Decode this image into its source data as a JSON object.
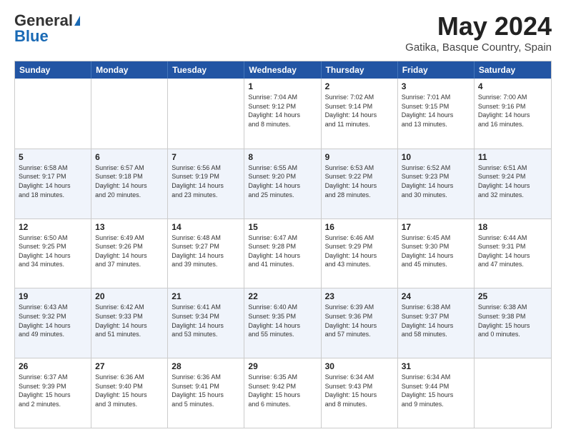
{
  "logo": {
    "line1": "General",
    "line2": "Blue"
  },
  "title": "May 2024",
  "subtitle": "Gatika, Basque Country, Spain",
  "days_of_week": [
    "Sunday",
    "Monday",
    "Tuesday",
    "Wednesday",
    "Thursday",
    "Friday",
    "Saturday"
  ],
  "weeks": [
    [
      {
        "day": "",
        "info": ""
      },
      {
        "day": "",
        "info": ""
      },
      {
        "day": "",
        "info": ""
      },
      {
        "day": "1",
        "info": "Sunrise: 7:04 AM\nSunset: 9:12 PM\nDaylight: 14 hours\nand 8 minutes."
      },
      {
        "day": "2",
        "info": "Sunrise: 7:02 AM\nSunset: 9:14 PM\nDaylight: 14 hours\nand 11 minutes."
      },
      {
        "day": "3",
        "info": "Sunrise: 7:01 AM\nSunset: 9:15 PM\nDaylight: 14 hours\nand 13 minutes."
      },
      {
        "day": "4",
        "info": "Sunrise: 7:00 AM\nSunset: 9:16 PM\nDaylight: 14 hours\nand 16 minutes."
      }
    ],
    [
      {
        "day": "5",
        "info": "Sunrise: 6:58 AM\nSunset: 9:17 PM\nDaylight: 14 hours\nand 18 minutes."
      },
      {
        "day": "6",
        "info": "Sunrise: 6:57 AM\nSunset: 9:18 PM\nDaylight: 14 hours\nand 20 minutes."
      },
      {
        "day": "7",
        "info": "Sunrise: 6:56 AM\nSunset: 9:19 PM\nDaylight: 14 hours\nand 23 minutes."
      },
      {
        "day": "8",
        "info": "Sunrise: 6:55 AM\nSunset: 9:20 PM\nDaylight: 14 hours\nand 25 minutes."
      },
      {
        "day": "9",
        "info": "Sunrise: 6:53 AM\nSunset: 9:22 PM\nDaylight: 14 hours\nand 28 minutes."
      },
      {
        "day": "10",
        "info": "Sunrise: 6:52 AM\nSunset: 9:23 PM\nDaylight: 14 hours\nand 30 minutes."
      },
      {
        "day": "11",
        "info": "Sunrise: 6:51 AM\nSunset: 9:24 PM\nDaylight: 14 hours\nand 32 minutes."
      }
    ],
    [
      {
        "day": "12",
        "info": "Sunrise: 6:50 AM\nSunset: 9:25 PM\nDaylight: 14 hours\nand 34 minutes."
      },
      {
        "day": "13",
        "info": "Sunrise: 6:49 AM\nSunset: 9:26 PM\nDaylight: 14 hours\nand 37 minutes."
      },
      {
        "day": "14",
        "info": "Sunrise: 6:48 AM\nSunset: 9:27 PM\nDaylight: 14 hours\nand 39 minutes."
      },
      {
        "day": "15",
        "info": "Sunrise: 6:47 AM\nSunset: 9:28 PM\nDaylight: 14 hours\nand 41 minutes."
      },
      {
        "day": "16",
        "info": "Sunrise: 6:46 AM\nSunset: 9:29 PM\nDaylight: 14 hours\nand 43 minutes."
      },
      {
        "day": "17",
        "info": "Sunrise: 6:45 AM\nSunset: 9:30 PM\nDaylight: 14 hours\nand 45 minutes."
      },
      {
        "day": "18",
        "info": "Sunrise: 6:44 AM\nSunset: 9:31 PM\nDaylight: 14 hours\nand 47 minutes."
      }
    ],
    [
      {
        "day": "19",
        "info": "Sunrise: 6:43 AM\nSunset: 9:32 PM\nDaylight: 14 hours\nand 49 minutes."
      },
      {
        "day": "20",
        "info": "Sunrise: 6:42 AM\nSunset: 9:33 PM\nDaylight: 14 hours\nand 51 minutes."
      },
      {
        "day": "21",
        "info": "Sunrise: 6:41 AM\nSunset: 9:34 PM\nDaylight: 14 hours\nand 53 minutes."
      },
      {
        "day": "22",
        "info": "Sunrise: 6:40 AM\nSunset: 9:35 PM\nDaylight: 14 hours\nand 55 minutes."
      },
      {
        "day": "23",
        "info": "Sunrise: 6:39 AM\nSunset: 9:36 PM\nDaylight: 14 hours\nand 57 minutes."
      },
      {
        "day": "24",
        "info": "Sunrise: 6:38 AM\nSunset: 9:37 PM\nDaylight: 14 hours\nand 58 minutes."
      },
      {
        "day": "25",
        "info": "Sunrise: 6:38 AM\nSunset: 9:38 PM\nDaylight: 15 hours\nand 0 minutes."
      }
    ],
    [
      {
        "day": "26",
        "info": "Sunrise: 6:37 AM\nSunset: 9:39 PM\nDaylight: 15 hours\nand 2 minutes."
      },
      {
        "day": "27",
        "info": "Sunrise: 6:36 AM\nSunset: 9:40 PM\nDaylight: 15 hours\nand 3 minutes."
      },
      {
        "day": "28",
        "info": "Sunrise: 6:36 AM\nSunset: 9:41 PM\nDaylight: 15 hours\nand 5 minutes."
      },
      {
        "day": "29",
        "info": "Sunrise: 6:35 AM\nSunset: 9:42 PM\nDaylight: 15 hours\nand 6 minutes."
      },
      {
        "day": "30",
        "info": "Sunrise: 6:34 AM\nSunset: 9:43 PM\nDaylight: 15 hours\nand 8 minutes."
      },
      {
        "day": "31",
        "info": "Sunrise: 6:34 AM\nSunset: 9:44 PM\nDaylight: 15 hours\nand 9 minutes."
      },
      {
        "day": "",
        "info": ""
      }
    ]
  ]
}
